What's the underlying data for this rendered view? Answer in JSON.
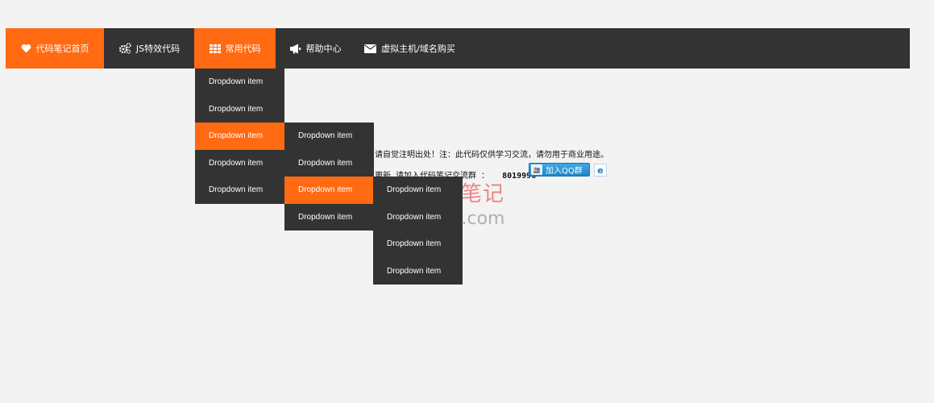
{
  "nav": {
    "items": [
      {
        "label": "代码笔记首页",
        "icon": "heart-icon"
      },
      {
        "label": "JS特效代码",
        "icon": "gears-icon"
      },
      {
        "label": "常用代码",
        "icon": "grid-icon"
      },
      {
        "label": "帮助中心",
        "icon": "megaphone-icon"
      },
      {
        "label": "虚拟主机/域名购买",
        "icon": "envelope-icon"
      }
    ]
  },
  "dropdown1": {
    "items": [
      "Dropdown item",
      "Dropdown item",
      "Dropdown item",
      "Dropdown item",
      "Dropdown item"
    ]
  },
  "dropdown2": {
    "items": [
      "Dropdown item",
      "Dropdown item",
      "Dropdown item",
      "Dropdown item"
    ]
  },
  "dropdown3": {
    "items": [
      "Dropdown item",
      "Dropdown item",
      "Dropdown item",
      "Dropdown item"
    ]
  },
  "notice": {
    "line1": "请自觉注明出处！注：此代码仅供学习交流，请勿用于商业用途。",
    "line2": "更新 请加入代码笔记交流群 ：",
    "group_number": "8019996",
    "qq_button": "加入QQ群"
  },
  "watermark": {
    "cn": "代码笔记",
    "en": "198zone.com"
  },
  "colors": {
    "accent": "#ff6a13",
    "nav_bg": "#333333",
    "page_bg": "#f3f3f3"
  }
}
